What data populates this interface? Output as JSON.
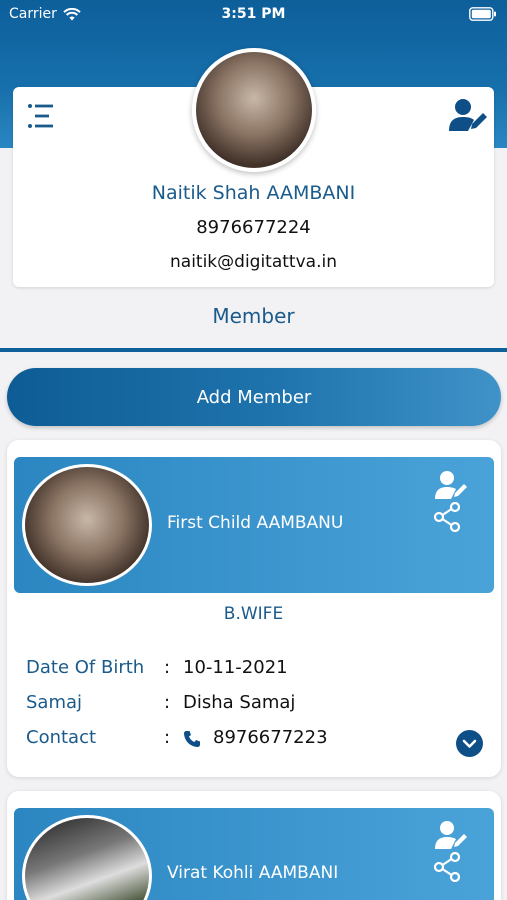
{
  "status_bar": {
    "carrier": "Carrier",
    "time": "3:51 PM"
  },
  "profile": {
    "name": "Naitik Shah AAMBANI",
    "phone": "8976677224",
    "email": "naitik@digitattva.in"
  },
  "section_title": "Member",
  "add_member_label": "Add Member",
  "labels": {
    "dob": "Date Of Birth",
    "samaj": "Samaj",
    "contact": "Contact",
    "colon": ":"
  },
  "members": [
    {
      "name": "First  Child AAMBANU",
      "relation": "B.WIFE",
      "dob": "10-11-2021",
      "samaj": "Disha Samaj",
      "contact": "8976677223"
    },
    {
      "name": "Virat Kohli AAMBANI"
    }
  ],
  "colors": {
    "brand": "#0f5f98",
    "accent_text": "#1a5b8c",
    "card_header": "#3e97cf"
  }
}
